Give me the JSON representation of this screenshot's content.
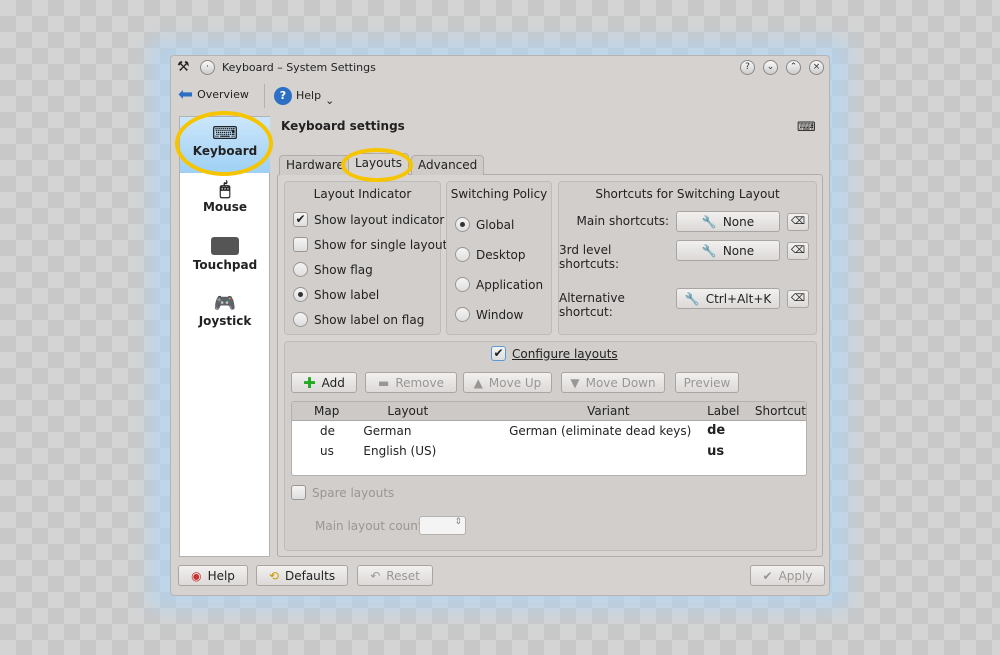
{
  "window": {
    "title": "Keyboard – System Settings"
  },
  "toolbar": {
    "overview": "Overview",
    "help": "Help"
  },
  "sidebar": {
    "items": [
      {
        "label": "Keyboard",
        "icon": "keyboard-icon",
        "selected": true
      },
      {
        "label": "Mouse",
        "icon": "mouse-icon"
      },
      {
        "label": "Touchpad",
        "icon": "touchpad-icon"
      },
      {
        "label": "Joystick",
        "icon": "joystick-icon"
      }
    ]
  },
  "main": {
    "title": "Keyboard settings",
    "tabs": [
      {
        "label": "Hardware"
      },
      {
        "label": "Layouts",
        "active": true
      },
      {
        "label": "Advanced"
      }
    ],
    "layout_indicator": {
      "title": "Layout Indicator",
      "options": [
        {
          "label": "Show layout indicator",
          "type": "checkbox",
          "checked": true
        },
        {
          "label": "Show for single layout",
          "type": "checkbox",
          "checked": false
        },
        {
          "label": "Show flag",
          "type": "radio",
          "checked": false
        },
        {
          "label": "Show label",
          "type": "radio",
          "checked": true
        },
        {
          "label": "Show label on flag",
          "type": "radio",
          "checked": false
        }
      ]
    },
    "switching_policy": {
      "title": "Switching Policy",
      "options": [
        {
          "label": "Global",
          "checked": true
        },
        {
          "label": "Desktop",
          "checked": false
        },
        {
          "label": "Application",
          "checked": false
        },
        {
          "label": "Window",
          "checked": false
        }
      ]
    },
    "shortcuts": {
      "title": "Shortcuts for Switching Layout",
      "rows": [
        {
          "label": "Main shortcuts:",
          "value": "None"
        },
        {
          "label": "3rd level shortcuts:",
          "value": "None"
        },
        {
          "label": "Alternative shortcut:",
          "value": "Ctrl+Alt+K"
        }
      ]
    },
    "configure": {
      "label": "Configure layouts",
      "checked": true,
      "buttons": {
        "add": "Add",
        "remove": "Remove",
        "move_up": "Move Up",
        "move_down": "Move Down",
        "preview": "Preview"
      },
      "columns": [
        "Map",
        "Layout",
        "Variant",
        "Label",
        "Shortcut"
      ],
      "rows": [
        [
          "de",
          "German",
          "German (eliminate dead keys)",
          "de",
          ""
        ],
        [
          "us",
          "English (US)",
          "",
          "us",
          ""
        ]
      ],
      "spare_layouts": "Spare layouts",
      "main_layout_count": "Main layout count:"
    }
  },
  "footer": {
    "help": "Help",
    "defaults": "Defaults",
    "reset": "Reset",
    "apply": "Apply"
  },
  "colors": {
    "highlight": "#f6c500",
    "selection": "#a8d4f5"
  }
}
